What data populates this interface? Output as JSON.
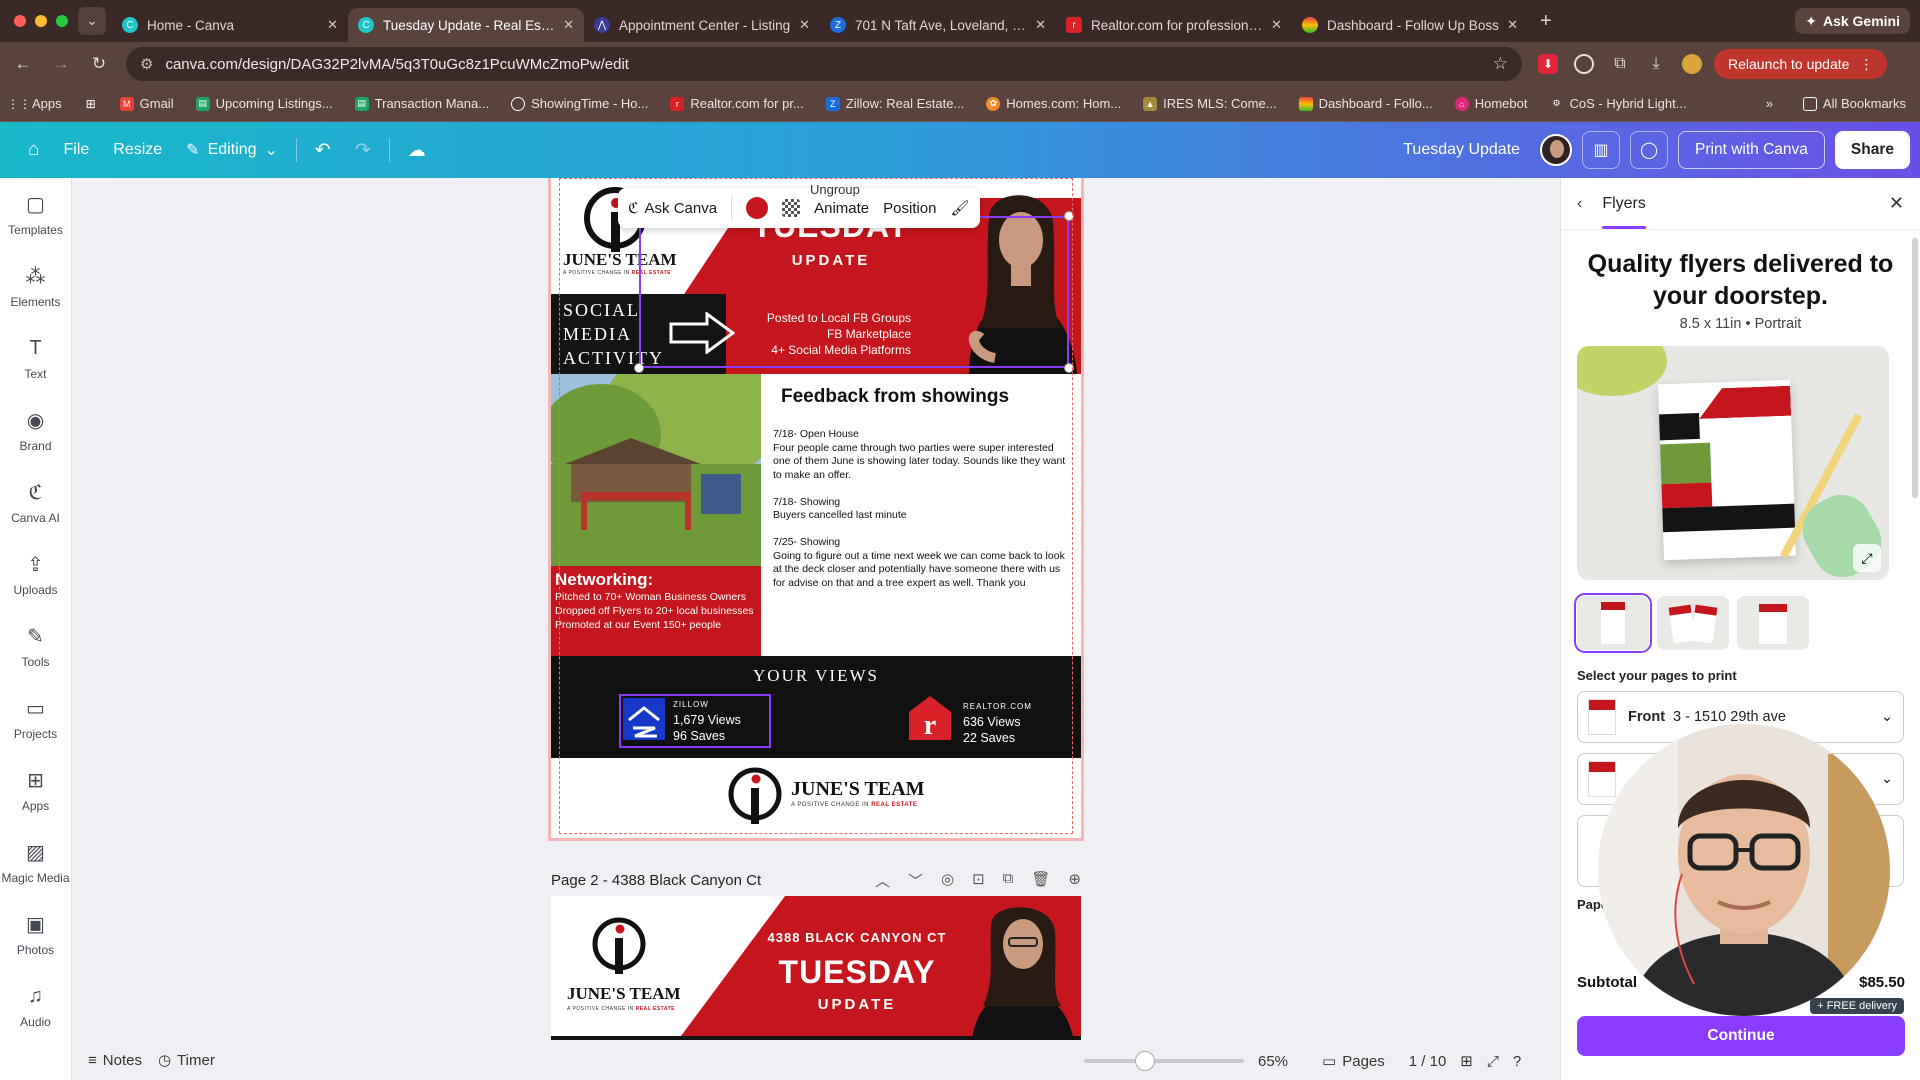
{
  "browser": {
    "tabs": [
      {
        "label": "Home - Canva",
        "active": false
      },
      {
        "label": "Tuesday Update - Real Estate",
        "active": true
      },
      {
        "label": "Appointment Center - Listing",
        "active": false
      },
      {
        "label": "701 N Taft Ave, Loveland, CO",
        "active": false
      },
      {
        "label": "Realtor.com for professionals",
        "active": false
      },
      {
        "label": "Dashboard - Follow Up Boss",
        "active": false
      }
    ],
    "gemini_label": "Ask Gemini",
    "url": "canva.com/design/DAG32P2lvMA/5q3T0uGc8z1PcuWMcZmoPw/edit",
    "relaunch_label": "Relaunch to update",
    "bookmarks": [
      "Apps",
      "Gmail",
      "Upcoming Listings...",
      "Transaction Mana...",
      "ShowingTime - Ho...",
      "Realtor.com for pr...",
      "Zillow: Real Estate...",
      "Homes.com: Hom...",
      "IRES MLS: Come...",
      "Dashboard - Follo...",
      "Homebot",
      "CoS - Hybrid Light..."
    ],
    "all_bookmarks": "All Bookmarks"
  },
  "toolbar": {
    "file": "File",
    "resize": "Resize",
    "editing": "Editing",
    "doc_name": "Tuesday Update",
    "print_label": "Print with Canva",
    "share_label": "Share"
  },
  "rail": [
    {
      "label": "Templates",
      "icon": "templates-icon"
    },
    {
      "label": "Elements",
      "icon": "elements-icon"
    },
    {
      "label": "Text",
      "icon": "text-icon"
    },
    {
      "label": "Brand",
      "icon": "brand-icon"
    },
    {
      "label": "Canva AI",
      "icon": "canva-ai-icon"
    },
    {
      "label": "Uploads",
      "icon": "uploads-icon"
    },
    {
      "label": "Tools",
      "icon": "tools-icon"
    },
    {
      "label": "Projects",
      "icon": "projects-icon"
    },
    {
      "label": "Apps",
      "icon": "apps-icon"
    },
    {
      "label": "Magic Media",
      "icon": "magic-media-icon"
    },
    {
      "label": "Photos",
      "icon": "photos-icon"
    },
    {
      "label": "Audio",
      "icon": "audio-icon"
    }
  ],
  "floatbar": {
    "ask": "Ask Canva",
    "animate": "Animate",
    "position": "Position",
    "ungroup": "Ungroup"
  },
  "page1": {
    "team_name": "JUNE'S TEAM",
    "tagline_a": "A POSITIVE CHANGE IN",
    "tagline_b": "REAL ESTATE",
    "social": "SOCIAL\nMEDIA\nACTIVITY",
    "tuesday": "TUESDAY",
    "update": "UPDATE",
    "posted_lines": [
      "Posted to Local FB Groups",
      "FB Marketplace",
      "4+ Social Media Platforms"
    ],
    "feedback_title": "Feedback from showings",
    "feedback_body": "7/18- Open House\nFour people came through two parties were super interested one of them June is showing later today. Sounds like they want to make an offer.\n\n7/18- Showing\nBuyers cancelled last minute\n\n7/25- Showing\nGoing to figure out a time next week we can come back to look at the deck closer and potentially have someone there with us for advise on that and a tree expert as well. Thank you",
    "networking_title": "Networking:",
    "networking_body": "Pitched to 70+ Woman Business Owners\nDropped off Flyers to 20+ local businesses\nPromoted at our Event 150+ people",
    "views_title": "YOUR VIEWS",
    "zillow_label": "ZILLOW",
    "zillow_views": "1,679 Views",
    "zillow_saves": "96 Saves",
    "realtor_label": "REALTOR.COM",
    "realtor_views": "636 Views",
    "realtor_saves": "22 Saves"
  },
  "page2": {
    "title": "Page 2 - 4388 Black Canyon Ct",
    "address": "4388 BLACK CANYON CT",
    "tuesday": "TUESDAY",
    "update": "UPDATE",
    "team_name": "JUNE'S TEAM",
    "tagline_a": "A POSITIVE CHANGE IN",
    "tagline_b": "REAL ESTATE"
  },
  "bottom": {
    "notes": "Notes",
    "timer": "Timer",
    "zoom": "65%",
    "pages": "Pages",
    "page_count": "1 / 10"
  },
  "panel": {
    "tab": "Flyers",
    "title": "Quality flyers delivered to your doorstep.",
    "subtitle": "8.5 x 11in • Portrait",
    "select_label": "Select your pages to print",
    "front_label": "Front",
    "front_value": "3 - 1510 29th ave",
    "paper_label": "Pape",
    "subtotal_label": "Subtotal",
    "subtotal_value": "$85.50",
    "free_delivery": "+ FREE delivery",
    "continue_label": "Continue"
  },
  "colors": {
    "canva_purple": "#8b3dff",
    "brand_red": "#c4161c",
    "toolbar_start": "#18b9c9",
    "toolbar_end": "#6a4fe6"
  }
}
